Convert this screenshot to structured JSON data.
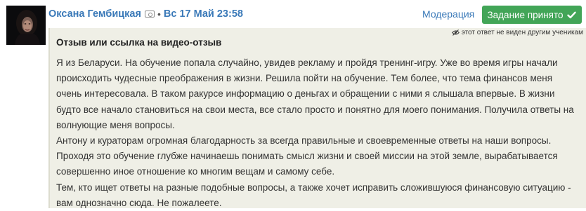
{
  "user": {
    "name": "Оксана Гембицкая",
    "badge_icon": "id-card-icon",
    "separator": "•",
    "date": "Вс 17 Май 23:58"
  },
  "actions": {
    "moderation_label": "Модерация",
    "accept_label": "Задание принято",
    "accept_icon": "checkmark-icon",
    "accept_color": "#42a557"
  },
  "post": {
    "private_note": "этот ответ не виден другим ученикам",
    "private_icon": "eye-off-icon",
    "section_title": "Отзыв или ссылка на видео-отзыв",
    "paragraphs": [
      "Я из Беларуси. На обучение попала случайно, увидев рекламу и пройдя тренинг-игру. Уже во время игры начали происходить чудесные преображения в жизни. Решила пойти на обучение. Тем более, что тема финансов меня очень интересовала. В таком ракурсе информацию о деньгах и обращении с ними я слышала впервые. В жизни будто все начало становиться на свои места, все стало просто и понятно для моего понимания. Получила ответы на волнующие меня вопросы.",
      "Антону и кураторам огромная благодарность за всегда правильные и своевременные ответы на наши вопросы. Проходя это обучение глубже начинаешь понимать смысл жизни и своей миссии на этой земле, вырабатывается совершенно иное отношение ко многим вещам и самому себе.",
      "Тем, кто ищет ответы на разные подобные вопросы, а также хочет исправить сложившуюся финансовую ситуацию - вам однозначно сюда. Не пожалеете."
    ]
  },
  "colors": {
    "link": "#3a79b8",
    "panel_bg": "#efefe6"
  }
}
